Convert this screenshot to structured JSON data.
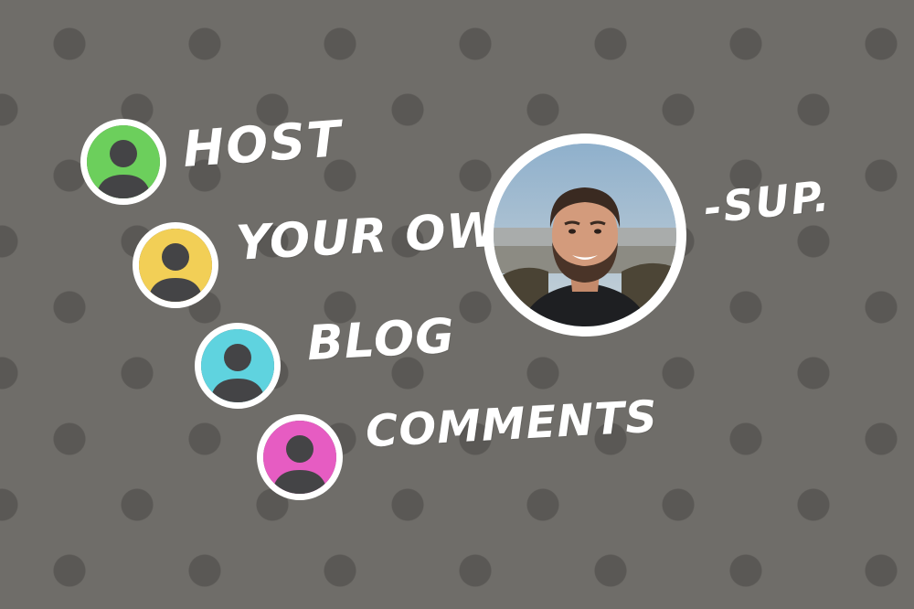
{
  "words": {
    "host": "HOST",
    "your_own": "YOUR OWN",
    "blog": "BLOG",
    "comments": "COMMENTS",
    "sup": "-SUP."
  },
  "colors": {
    "background": "#6f6d69",
    "dots": "#5a5855",
    "avatar_1": "#6ccf5c",
    "avatar_2": "#f2cf56",
    "avatar_3": "#5fd3df",
    "avatar_4": "#e65cc2",
    "silhouette": "#444446",
    "ring": "#ffffff"
  },
  "avatars": [
    {
      "icon": "user-avatar-icon",
      "color": "green"
    },
    {
      "icon": "user-avatar-icon",
      "color": "yellow"
    },
    {
      "icon": "user-avatar-icon",
      "color": "cyan"
    },
    {
      "icon": "user-avatar-icon",
      "color": "pink"
    }
  ],
  "portrait": {
    "icon": "author-photo"
  }
}
